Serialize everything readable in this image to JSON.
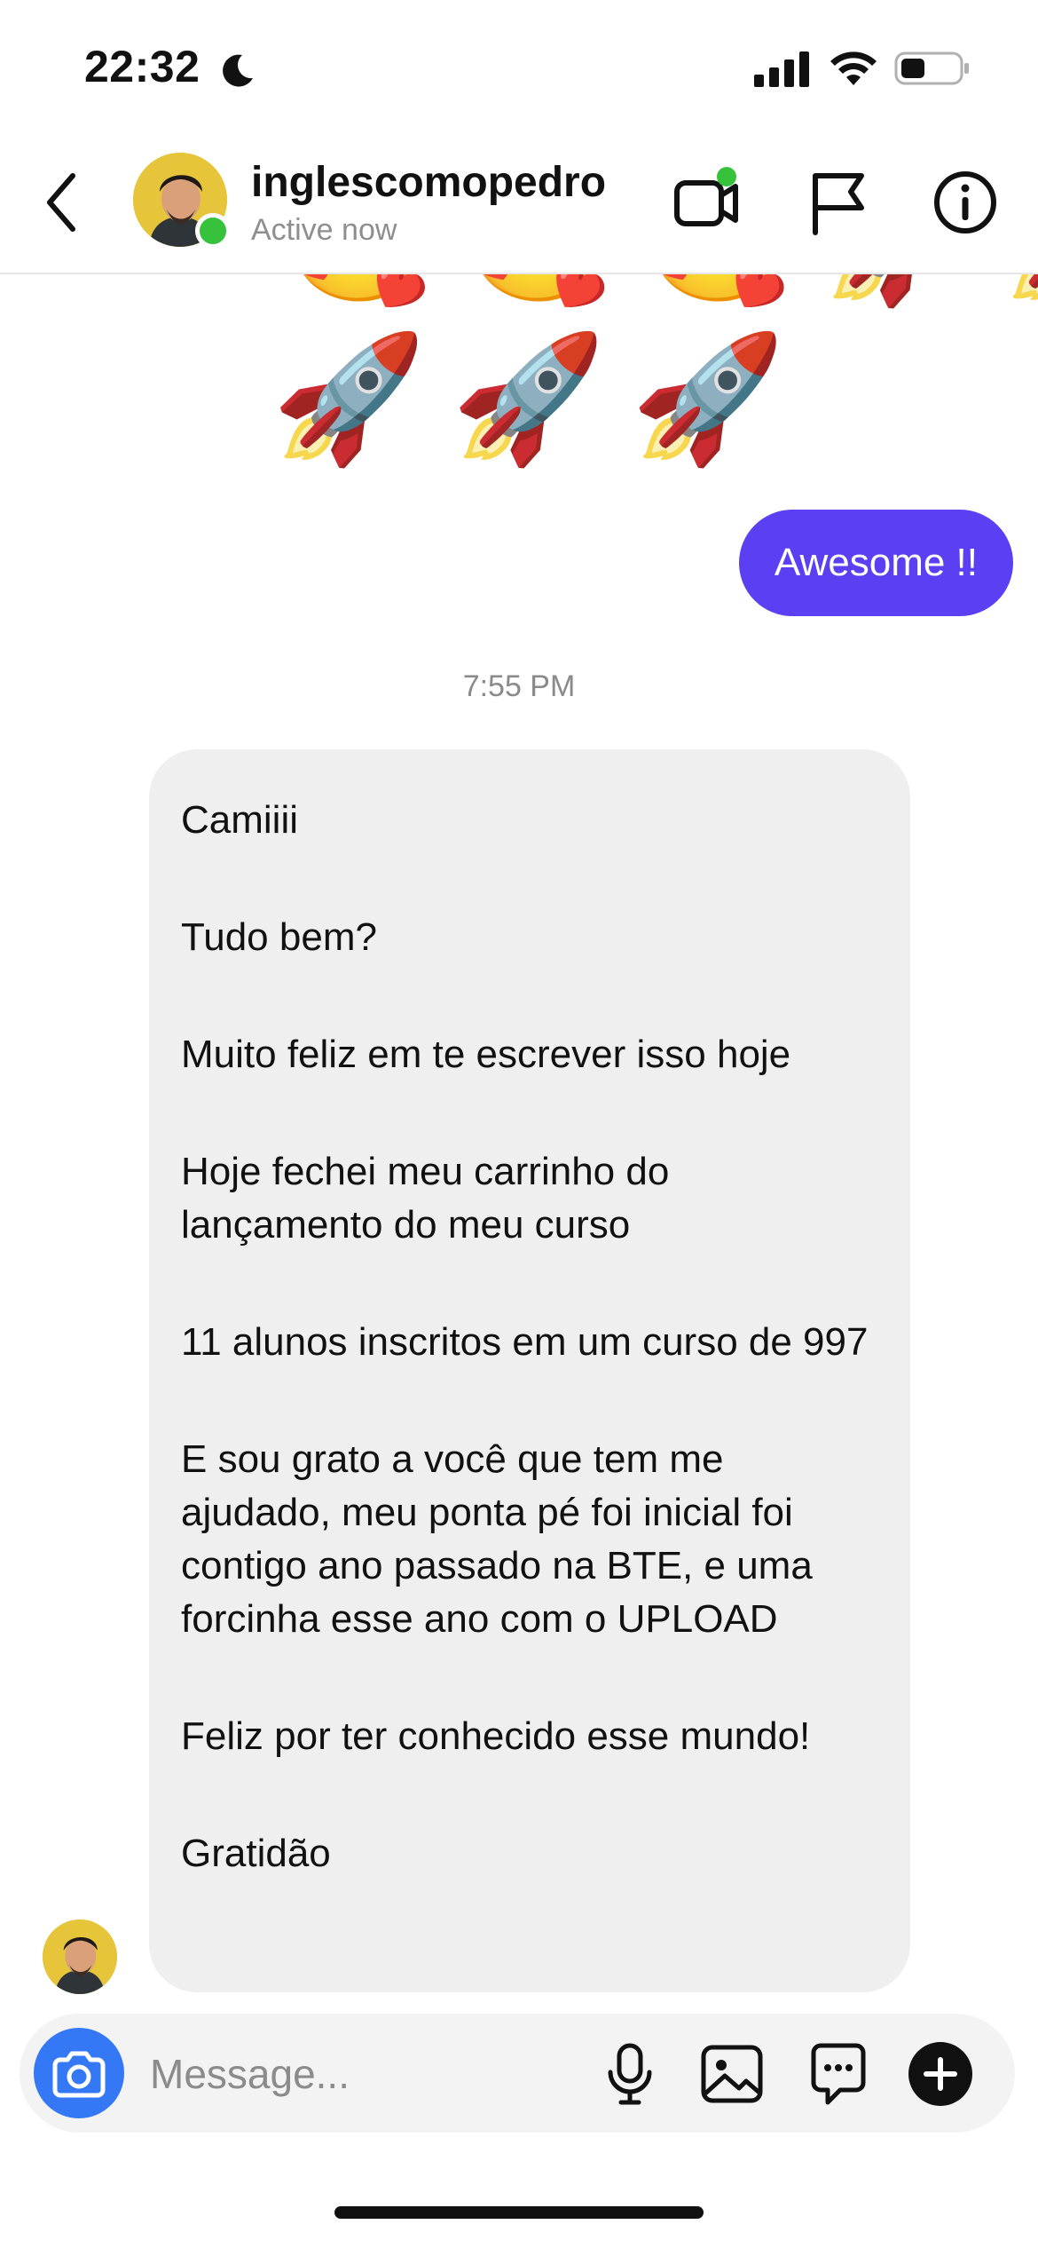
{
  "status_bar": {
    "time": "22:32",
    "icons": [
      "moon-icon",
      "signal-icon",
      "wifi-icon",
      "battery-icon"
    ]
  },
  "header": {
    "username": "inglescomopedro",
    "status": "Active now",
    "icons": [
      "back-chevron-icon",
      "video-call-icon",
      "flag-icon",
      "info-icon"
    ]
  },
  "messages": {
    "emoji_top": "🥰🥰🥰🚀🚀",
    "emoji_rockets": "🚀🚀🚀",
    "sent_text": "Awesome !!",
    "timestamp": "7:55 PM",
    "received": [
      "Camiiii",
      "Tudo bem?",
      "Muito feliz em te escrever isso hoje",
      "Hoje fechei meu carrinho do lançamento do meu curso",
      "11 alunos inscritos em um curso de 997",
      "E sou grato a você que tem me ajudado, meu ponta pé foi inicial foi contigo ano passado na BTE, e uma forcinha esse ano com o UPLOAD",
      "Feliz por ter conhecido esse mundo!",
      "Gratidão"
    ]
  },
  "composer": {
    "placeholder": "Message...",
    "icons": [
      "camera-icon",
      "microphone-icon",
      "gallery-icon",
      "sticker-icon",
      "plus-icon"
    ]
  },
  "colors": {
    "sent_bubble": "#5b3ff3",
    "received_bubble": "#efefef",
    "camera_button": "#3478f6",
    "online": "#37c23b"
  }
}
